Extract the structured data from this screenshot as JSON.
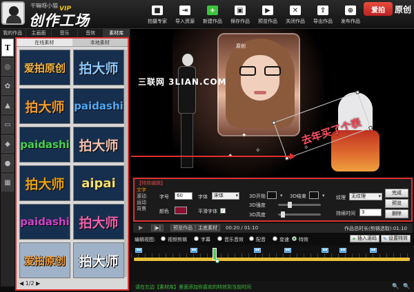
{
  "header": {
    "user_name": "干嘛呀小猫",
    "vip": "VIP",
    "app_title": "创作工场",
    "brand": {
      "logo": "爱拍",
      "text": "原创"
    },
    "toolbar": [
      {
        "label": "拍摄专家",
        "icon": "camera-icon",
        "color": "#ffffff"
      },
      {
        "label": "导入资源",
        "icon": "import-icon",
        "color": "#ffffff"
      },
      {
        "label": "新建作品",
        "icon": "plus-icon",
        "color": "#3cc43c"
      },
      {
        "label": "保存作品",
        "icon": "save-icon",
        "color": "#ffffff"
      },
      {
        "label": "预览作品",
        "icon": "preview-icon",
        "color": "#ffffff"
      },
      {
        "label": "关闭作品",
        "icon": "close-icon",
        "color": "#ffffff"
      },
      {
        "label": "导出作品",
        "icon": "export-icon",
        "color": "#ffffff"
      },
      {
        "label": "发布作品",
        "icon": "publish-icon",
        "color": "#ffffff"
      }
    ]
  },
  "left": {
    "tabs": [
      "我的作品",
      "主画面",
      "音乐",
      "音效",
      "素材库"
    ],
    "active_tab": "素材库",
    "tools": [
      {
        "label": "T",
        "icon": "text-icon"
      },
      {
        "label": "◎",
        "icon": "search-icon"
      },
      {
        "label": "✿",
        "icon": "flower-icon"
      },
      {
        "label": "▲",
        "icon": "image-icon"
      },
      {
        "label": "▭",
        "icon": "frame-icon"
      },
      {
        "label": "◆",
        "icon": "shape-icon"
      },
      {
        "label": "●",
        "icon": "brush-icon"
      },
      {
        "label": "▦",
        "icon": "picture-icon"
      }
    ],
    "subtabs": [
      "在线素材",
      "本地素材"
    ],
    "tiles": [
      {
        "text": "爱拍原创",
        "color": "#f5b640",
        "light": false
      },
      {
        "text": "拍大师",
        "color": "#8ec8ff",
        "light": false
      },
      {
        "text": "拍大师",
        "color": "#f39b2c",
        "light": false
      },
      {
        "text": "paidashi",
        "color": "#4ba8ff",
        "light": false
      },
      {
        "text": "paidashi",
        "color": "#44d454",
        "light": false
      },
      {
        "text": "拍大师",
        "color": "#f2c0b0",
        "light": false
      },
      {
        "text": "拍大师",
        "color": "#e8a010",
        "light": false
      },
      {
        "text": "aipai",
        "color": "#f4e070",
        "light": false
      },
      {
        "text": "paidashi",
        "color": "#d040d0",
        "light": false
      },
      {
        "text": "拍大师",
        "color": "#f060b0",
        "light": false
      },
      {
        "text": "爱拍原创",
        "color": "#f5a040",
        "light": true
      },
      {
        "text": "拍大师",
        "color": "#ffffff",
        "light": true
      }
    ],
    "pager": "◀ 1/2 ▶"
  },
  "preview": {
    "watermark": "三联网 3LIAN.COM",
    "frame_label": "原创",
    "caption": "去年买了个表"
  },
  "effects": {
    "title": "【特效编辑】",
    "types": [
      "文字",
      "滚动",
      "运动",
      "背景"
    ],
    "active_type": "文字",
    "size_label": "字号",
    "size_value": "60",
    "font_label": "字体",
    "font_value": "宋体",
    "color_label": "颜色",
    "color_value": "#8a1030",
    "smooth_label": "平滑字体",
    "smooth_checked": true,
    "start3d_label": "3D开始",
    "start_color": "#111111",
    "end3d_label": "3D结束",
    "end_color": "#111111",
    "strength_label": "3D强度",
    "height_label": "3D高度",
    "texture_label": "纹理",
    "texture_value": "无纹理",
    "duration_label": "持续时间",
    "duration_value": "3",
    "buttons": [
      "完成",
      "预览",
      "删除"
    ]
  },
  "transport": {
    "play_icon": "▶",
    "frame_btn": "|▶|",
    "preview_btn": "预览作品",
    "master_btn": "主底素材",
    "time": "00:20 / 01:10",
    "total": "作品总时长(剪辑选取):01:10"
  },
  "viewrow": {
    "label": "编辑视图:",
    "options": [
      "视频剪辑",
      "字幕",
      "音乐音效",
      "配音",
      "变速",
      "特效"
    ],
    "selected": "特效",
    "insert_btn": "插入滚码",
    "setting_btn": "设置特效"
  },
  "status": {
    "text": "请在左边【素材库】里面添加你喜欢的特效到当前时间"
  }
}
